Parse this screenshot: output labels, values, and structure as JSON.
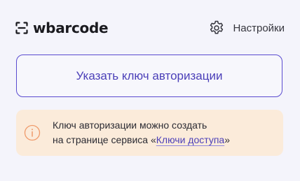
{
  "header": {
    "brand_name": "wbarcode",
    "brand_icon": "barcode-scan-icon",
    "settings_icon": "gear-icon",
    "settings_label": "Настройки"
  },
  "auth_button": {
    "label": "Указать ключ авторизации"
  },
  "notice": {
    "icon": "info-icon",
    "line1": "Ключ авторизации можно создать",
    "line2_prefix": "на странице сервиса «",
    "link_label": "Ключи доступа",
    "line2_suffix": "»"
  },
  "colors": {
    "accent": "#4b3fb8",
    "notice_background": "#fbebda",
    "info_icon": "#ef9a6a",
    "page_background": "#f4f4fb"
  }
}
